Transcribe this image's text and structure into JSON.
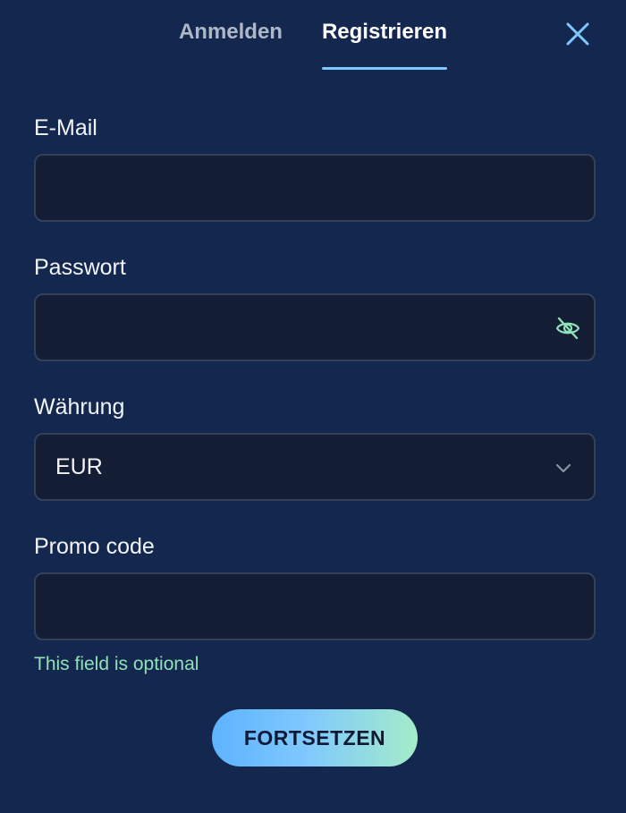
{
  "tabs": {
    "login_label": "Anmelden",
    "register_label": "Registrieren",
    "active": "register"
  },
  "form": {
    "email": {
      "label": "E-Mail",
      "value": "",
      "placeholder": ""
    },
    "password": {
      "label": "Passwort",
      "value": "",
      "placeholder": ""
    },
    "currency": {
      "label": "Währung",
      "selected": "EUR"
    },
    "promo": {
      "label": "Promo code",
      "value": "",
      "placeholder": "",
      "hint": "This field is optional"
    }
  },
  "actions": {
    "submit_label": "FORTSETZEN"
  },
  "icons": {
    "close": "close-icon",
    "password_toggle": "eye-off-icon",
    "currency_dropdown": "chevron-down-icon"
  },
  "colors": {
    "background": "#14284f",
    "input_background": "#131d33",
    "accent": "#7fc7ff",
    "hint": "#8fe0b8",
    "eye_icon": "#8fe0b8"
  }
}
